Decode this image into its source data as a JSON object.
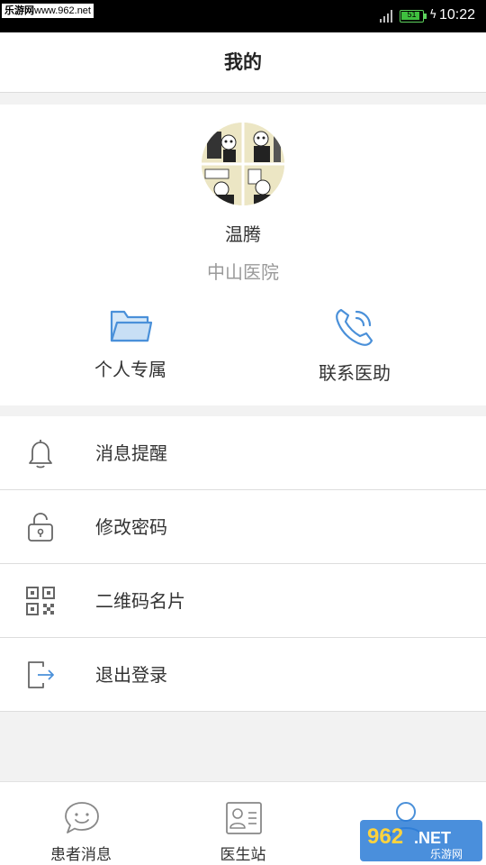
{
  "status_bar": {
    "watermark_prefix": "乐游网",
    "watermark_url": "www.962.net",
    "battery_level": "51",
    "time": "10:22",
    "battery_color": "#3fbf3f"
  },
  "header": {
    "title": "我的"
  },
  "profile": {
    "avatar_icon": "avatar-comic-image",
    "name": "温腾",
    "hospital": "中山医院"
  },
  "quick_actions": [
    {
      "label": "个人专属",
      "icon": "folder-icon"
    },
    {
      "label": "联系医助",
      "icon": "phone-icon"
    }
  ],
  "menu": [
    {
      "label": "消息提醒",
      "icon": "bell-icon"
    },
    {
      "label": "修改密码",
      "icon": "lock-icon"
    },
    {
      "label": "二维码名片",
      "icon": "qr-code-icon"
    },
    {
      "label": "退出登录",
      "icon": "logout-icon"
    }
  ],
  "bottom_nav": [
    {
      "label": "患者消息",
      "icon": "chat-bubble-icon"
    },
    {
      "label": "医生站",
      "icon": "id-card-icon"
    },
    {
      "label": "",
      "icon": "person-icon",
      "active": true
    }
  ],
  "corner_watermark": {
    "brand": "962",
    "suffix": ".NET",
    "caption": "乐游网"
  },
  "colors": {
    "accent": "#4a90d9",
    "icon_gray": "#666666"
  }
}
